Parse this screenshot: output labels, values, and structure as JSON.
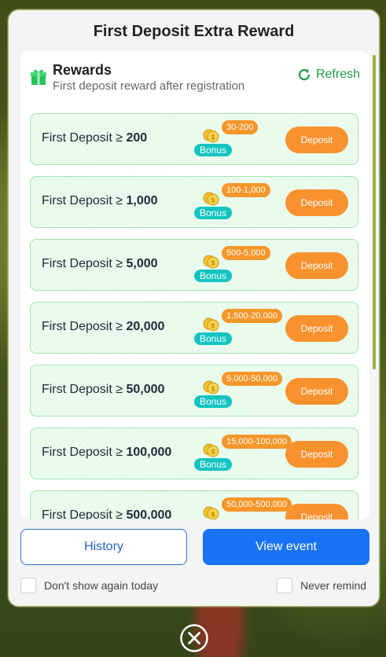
{
  "modal": {
    "title": "First Deposit Extra Reward"
  },
  "rewards": {
    "title": "Rewards",
    "subtitle": "First deposit reward after registration",
    "refresh_label": "Refresh",
    "items": [
      {
        "prefix": "First Deposit ≥",
        "amount": "200",
        "range": "30-200",
        "bonus": "Bonus",
        "button": "Deposit"
      },
      {
        "prefix": "First Deposit ≥",
        "amount": "1,000",
        "range": "100-1,000",
        "bonus": "Bonus",
        "button": "Deposit"
      },
      {
        "prefix": "First Deposit ≥",
        "amount": "5,000",
        "range": "500-5,000",
        "bonus": "Bonus",
        "button": "Deposit"
      },
      {
        "prefix": "First Deposit ≥",
        "amount": "20,000",
        "range": "1,500-20,000",
        "bonus": "Bonus",
        "button": "Deposit"
      },
      {
        "prefix": "First Deposit ≥",
        "amount": "50,000",
        "range": "5,000-50,000",
        "bonus": "Bonus",
        "button": "Deposit"
      },
      {
        "prefix": "First Deposit ≥",
        "amount": "100,000",
        "range": "15,000-100,000",
        "bonus": "Bonus",
        "button": "Deposit"
      },
      {
        "prefix": "First Deposit ≥",
        "amount": "500,000",
        "range": "50,000-500,000",
        "bonus": "Bonus",
        "button": "Deposit"
      }
    ]
  },
  "actions": {
    "history_label": "History",
    "view_event_label": "View event"
  },
  "options": {
    "dont_show_today": "Don't show again today",
    "never_remind": "Never remind"
  },
  "colors": {
    "accent_green": "#1f9b45",
    "deposit_orange": "#f7922f",
    "primary_blue": "#1a73f5",
    "bonus_teal": "#14c4c1"
  },
  "icons": {
    "gift": "gift-icon",
    "refresh": "refresh-icon",
    "coin": "coin-icon",
    "close": "close-icon"
  }
}
